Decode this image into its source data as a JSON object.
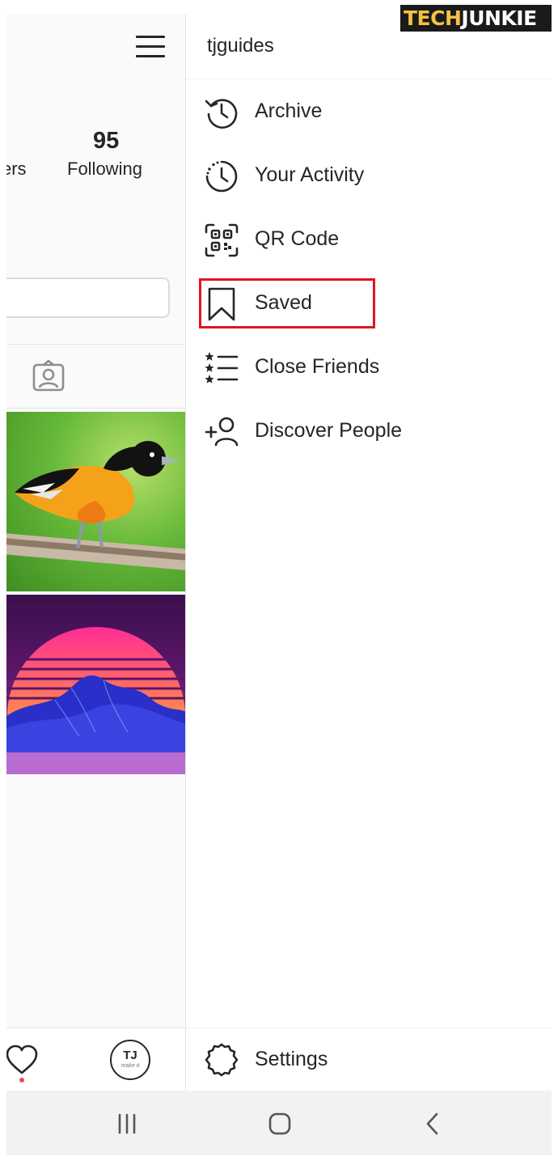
{
  "watermark": {
    "part1": "TECH",
    "part2": "JUNKIE"
  },
  "profile": {
    "followers_label_partial": "ers",
    "following_count": "95",
    "following_label": "Following",
    "avatar_initials": "TJ",
    "avatar_tagline": "make it"
  },
  "menu": {
    "username": "tjguides",
    "items": [
      {
        "label": "Archive",
        "icon": "archive-icon"
      },
      {
        "label": "Your Activity",
        "icon": "activity-icon"
      },
      {
        "label": "QR Code",
        "icon": "qr-code-icon"
      },
      {
        "label": "Saved",
        "icon": "bookmark-icon",
        "highlighted": true
      },
      {
        "label": "Close Friends",
        "icon": "close-friends-icon"
      },
      {
        "label": "Discover People",
        "icon": "add-person-icon"
      }
    ],
    "settings_label": "Settings"
  },
  "colors": {
    "highlight": "#e0161e",
    "notification_dot": "#ed4956",
    "text": "#262626",
    "logo_yellow": "#f5c242"
  },
  "system_nav": [
    "recents-icon",
    "home-icon",
    "back-icon"
  ]
}
